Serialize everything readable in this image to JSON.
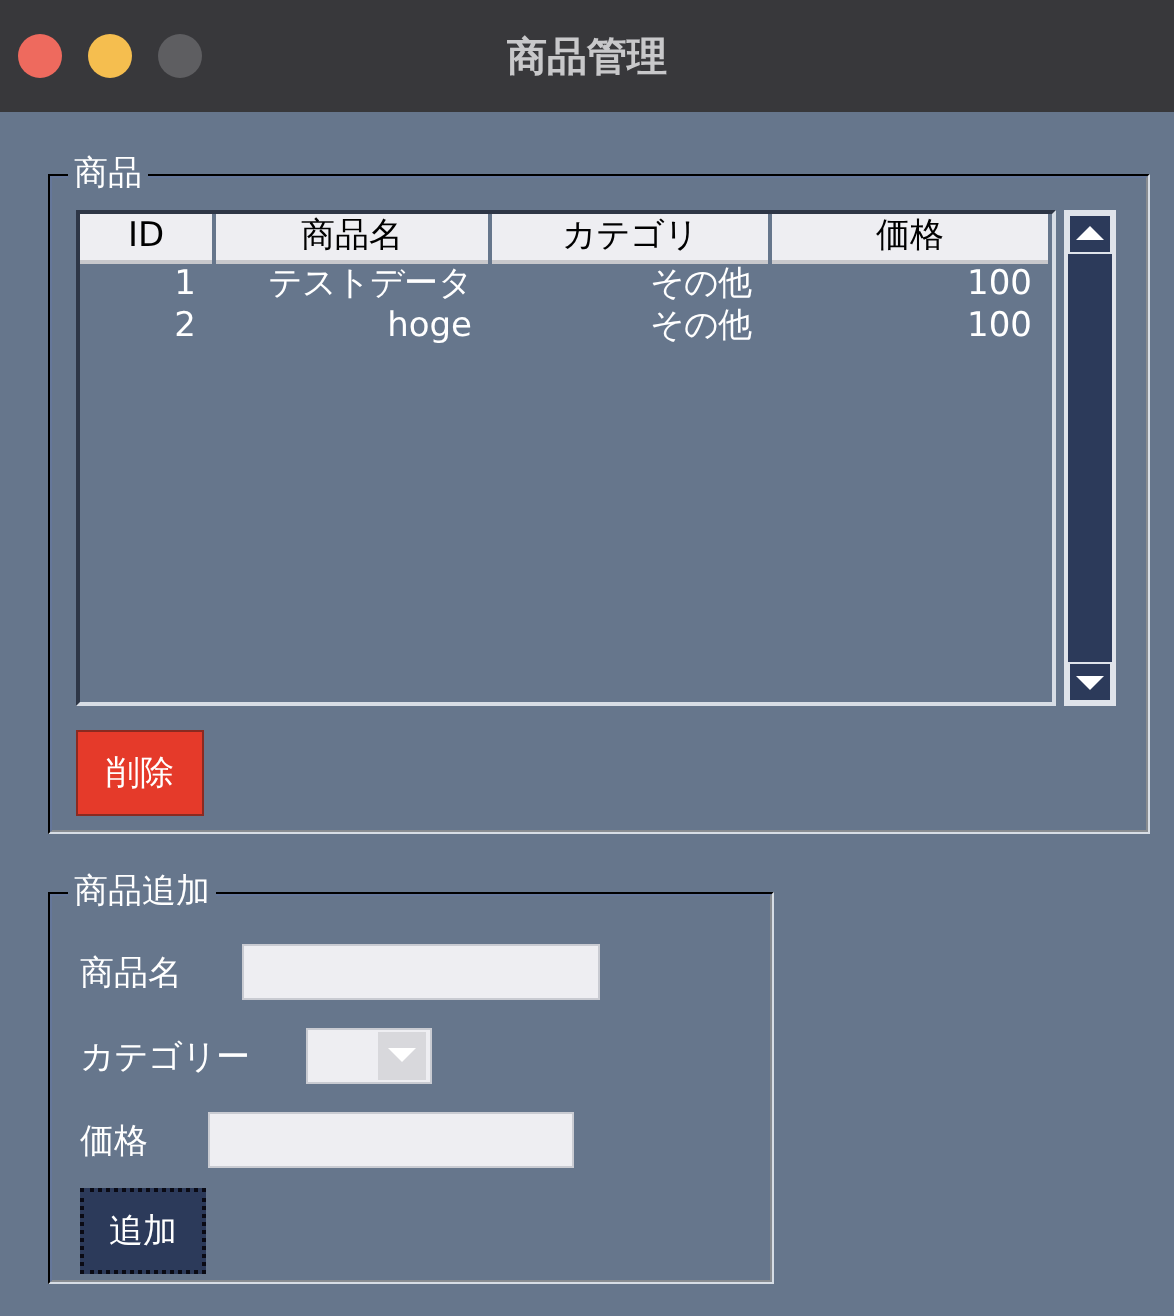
{
  "window": {
    "title": "商品管理"
  },
  "product_group": {
    "title": "商品",
    "table": {
      "columns": [
        "ID",
        "商品名",
        "カテゴリ",
        "価格"
      ],
      "rows": [
        {
          "cells": [
            "1",
            "テストデータ",
            "その他",
            "100"
          ]
        },
        {
          "cells": [
            "2",
            "hoge",
            "その他",
            "100"
          ]
        }
      ]
    },
    "delete_button": "削除"
  },
  "add_group": {
    "title": "商品追加",
    "fields": [
      {
        "kind": "text",
        "label": "商品名"
      },
      {
        "kind": "combo",
        "label": "カテゴリー"
      },
      {
        "kind": "text",
        "label": "価格"
      }
    ],
    "add_button": "追加"
  }
}
